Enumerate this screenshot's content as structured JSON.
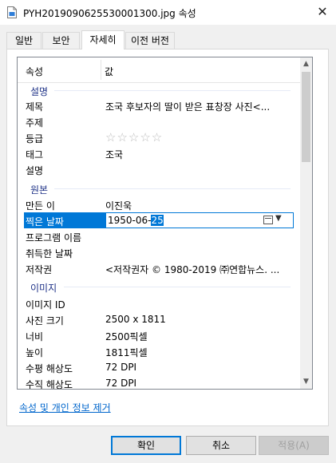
{
  "window": {
    "title": "PYH2019090625530001300.jpg 속성",
    "close_glyph": "✕"
  },
  "tabs": [
    {
      "label": "일반"
    },
    {
      "label": "보안"
    },
    {
      "label": "자세히",
      "active": true
    },
    {
      "label": "이전 버전"
    }
  ],
  "details": {
    "header": {
      "property": "속성",
      "value": "값"
    },
    "groups": {
      "description": "설명",
      "origin": "원본",
      "image": "이미지"
    },
    "rows": {
      "title": {
        "key": "제목",
        "value": "조국 후보자의 딸이 받은 표창장 사진<..."
      },
      "subject": {
        "key": "주제",
        "value": ""
      },
      "rating": {
        "key": "등급",
        "stars": "☆☆☆☆☆",
        "value": 0
      },
      "tags": {
        "key": "태그",
        "value": "조국"
      },
      "comments": {
        "key": "설명",
        "value": ""
      },
      "authors": {
        "key": "만든 이",
        "value": "이진욱"
      },
      "date_taken": {
        "key": "찍은 날짜",
        "value_prefix": "1950-06-",
        "value_selected": "25"
      },
      "program": {
        "key": "프로그램 이름",
        "value": ""
      },
      "date_acquired": {
        "key": "취득한 날짜",
        "value": ""
      },
      "copyright": {
        "key": "저작권",
        "value": "<저작권자 © 1980-2019 ㈜연합뉴스. ..."
      },
      "image_id": {
        "key": "이미지 ID",
        "value": ""
      },
      "dimensions": {
        "key": "사진 크기",
        "value": "2500 x 1811"
      },
      "width": {
        "key": "너비",
        "value": "2500픽셀"
      },
      "height": {
        "key": "높이",
        "value": "1811픽셀"
      },
      "hres": {
        "key": "수평 해상도",
        "value": "72 DPI"
      },
      "vres": {
        "key": "수직 해상도",
        "value": "72 DPI"
      }
    }
  },
  "link_remove": "속성 및 개인 정보 제거",
  "buttons": {
    "ok": "확인",
    "cancel": "취소",
    "apply": "적용(A)"
  },
  "colors": {
    "selection": "#0078d7",
    "group_text": "#1e3287",
    "link": "#0066cc"
  }
}
